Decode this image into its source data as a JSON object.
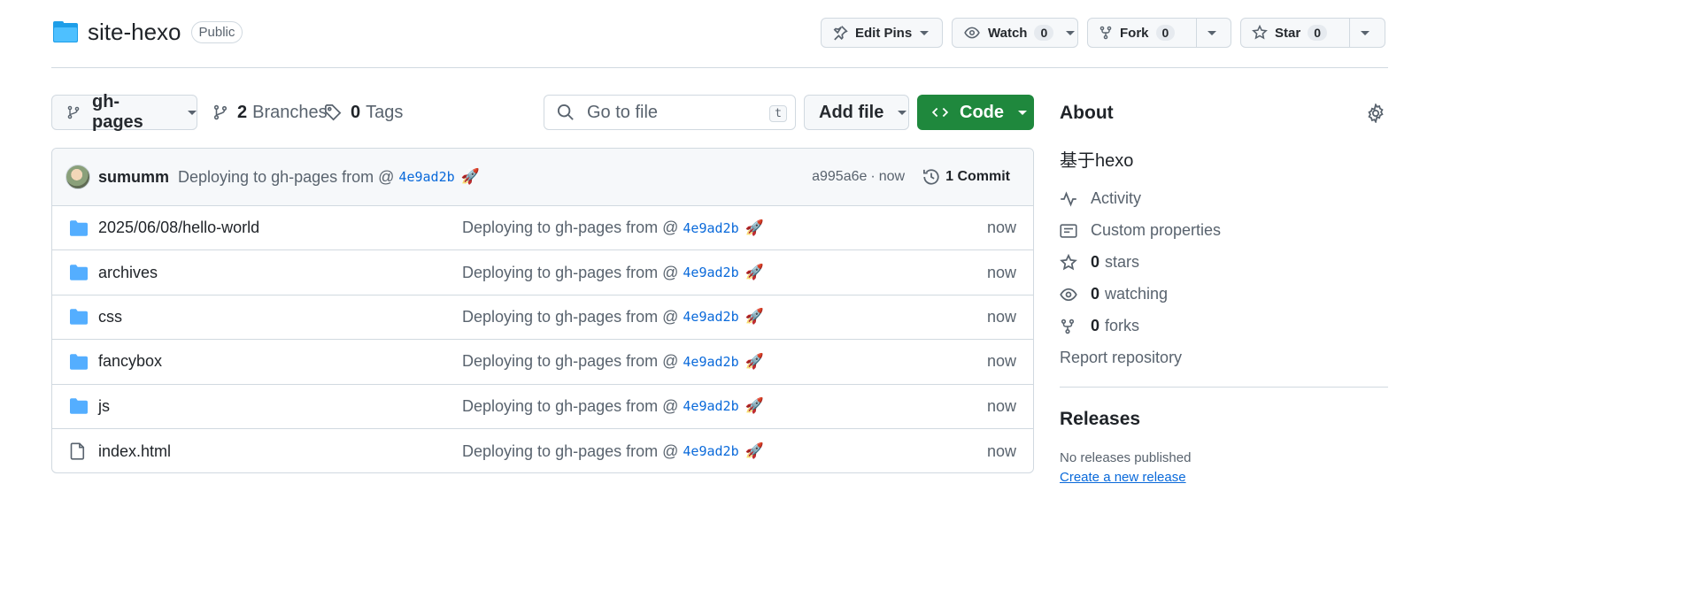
{
  "repo": {
    "name": "site-hexo",
    "visibility": "Public"
  },
  "header_actions": {
    "edit_pins": "Edit Pins",
    "watch": "Watch",
    "watch_count": "0",
    "fork": "Fork",
    "fork_count": "0",
    "star": "Star",
    "star_count": "0"
  },
  "nav": {
    "branch": "gh-pages",
    "branches_count": "2",
    "branches_label": "Branches",
    "tags_count": "0",
    "tags_label": "Tags",
    "search_placeholder": "Go to file",
    "search_shortcut": "t",
    "add_file": "Add file",
    "code": "Code"
  },
  "latest_commit": {
    "author": "sumumm",
    "message": "Deploying to gh-pages from @",
    "sha_link": "4e9ad2b",
    "emoji": "🚀",
    "short_sha": "a995a6e",
    "separator": "·",
    "time": "now",
    "commits_count_label": "1 Commit"
  },
  "files": [
    {
      "name": "2025/06/08/hello-world",
      "type": "folder",
      "message": "Deploying to gh-pages from @",
      "sha": "4e9ad2b",
      "emoji": "🚀",
      "date": "now"
    },
    {
      "name": "archives",
      "type": "folder",
      "message": "Deploying to gh-pages from @",
      "sha": "4e9ad2b",
      "emoji": "🚀",
      "date": "now"
    },
    {
      "name": "css",
      "type": "folder",
      "message": "Deploying to gh-pages from @",
      "sha": "4e9ad2b",
      "emoji": "🚀",
      "date": "now"
    },
    {
      "name": "fancybox",
      "type": "folder",
      "message": "Deploying to gh-pages from @",
      "sha": "4e9ad2b",
      "emoji": "🚀",
      "date": "now"
    },
    {
      "name": "js",
      "type": "folder",
      "message": "Deploying to gh-pages from @",
      "sha": "4e9ad2b",
      "emoji": "🚀",
      "date": "now"
    },
    {
      "name": "index.html",
      "type": "file",
      "message": "Deploying to gh-pages from @",
      "sha": "4e9ad2b",
      "emoji": "🚀",
      "date": "now"
    }
  ],
  "about": {
    "title": "About",
    "description": "基于hexo",
    "activity": "Activity",
    "custom_properties": "Custom properties",
    "stars_count": "0",
    "stars_label": "stars",
    "watching_count": "0",
    "watching_label": "watching",
    "forks_count": "0",
    "forks_label": "forks",
    "report": "Report repository"
  },
  "releases": {
    "title": "Releases",
    "none": "No releases published",
    "create": "Create a new release"
  },
  "colors": {
    "accent_green": "#1f883d",
    "link_blue": "#0969da",
    "folder_blue": "#54aeff",
    "muted_text": "#59636e",
    "border": "#d1d9e0"
  }
}
